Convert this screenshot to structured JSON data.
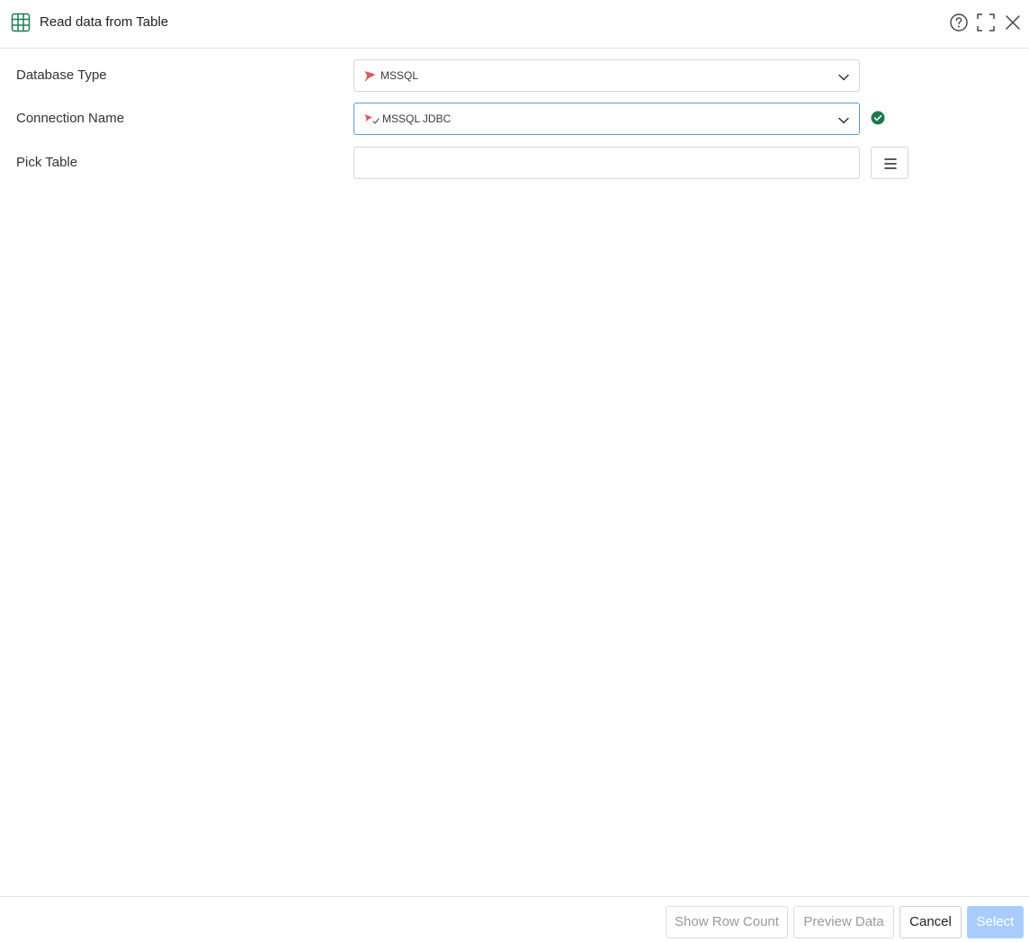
{
  "dialog": {
    "title": "Read data from Table",
    "header_icons": [
      "table-icon",
      "help-icon",
      "maximize-icon",
      "close-icon"
    ]
  },
  "form": {
    "database_type": {
      "label": "Database Type",
      "value": "MSSQL",
      "icon": "mssql-icon"
    },
    "connection_name": {
      "label": "Connection Name",
      "value": "MSSQL JDBC",
      "icon": "mssql-connection-icon",
      "status": "connected"
    },
    "pick_table": {
      "label": "Pick Table",
      "value": "",
      "placeholder": ""
    }
  },
  "footer": {
    "show_row_count": "Show Row Count",
    "preview_data": "Preview Data",
    "cancel": "Cancel",
    "select": "Select"
  },
  "colors": {
    "accent_green": "#1e7a4e",
    "select_button": "#a8cdfb",
    "focus_border": "#5b9bd5"
  }
}
